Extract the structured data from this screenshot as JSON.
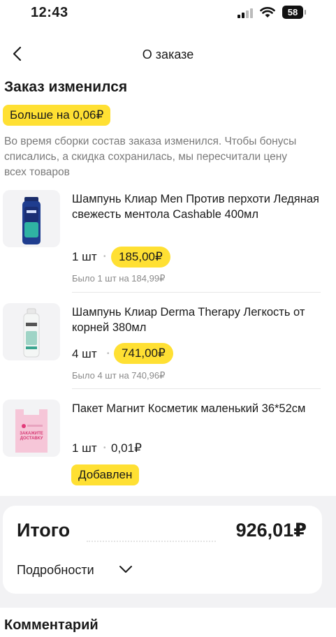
{
  "status_bar": {
    "time": "12:43",
    "battery": "58"
  },
  "nav": {
    "title": "О заказе",
    "back_icon": "chevron-left-icon"
  },
  "changes": {
    "title": "Заказ изменился",
    "badge": "Больше на 0,06₽",
    "notice": "Во время сборки состав заказа изменился. Чтобы бонусы списались, а скидка сохранилась, мы пересчитали цену всех товаров"
  },
  "items": [
    {
      "name": "Шампунь Клиар Men Против перхоти Ледяная свежесть ментола Cashable 400мл",
      "qty": "1 шт",
      "price": "185,00₽",
      "old": "Было 1 шт на 184,99₽"
    },
    {
      "name": "Шампунь Клиар Derma Therapy Легкость от корней 380мл",
      "qty": "4 шт",
      "price": "741,00₽",
      "old": "Было 4 шт на 740,96₽"
    },
    {
      "name": "Пакет Магнит Косметик маленький 36*52см",
      "qty": "1 шт",
      "price": "0,01₽",
      "status": "Добавлен",
      "bag_text": "ЗАКАЖИТЕ ДОСТАВКУ"
    }
  ],
  "total": {
    "label": "Итого",
    "value": "926,01₽",
    "details": "Подробности"
  },
  "comment": {
    "title": "Комментарий"
  },
  "colors": {
    "accent": "#ffe033",
    "muted": "#7a7a7a",
    "background_gray": "#f2f2f4"
  }
}
